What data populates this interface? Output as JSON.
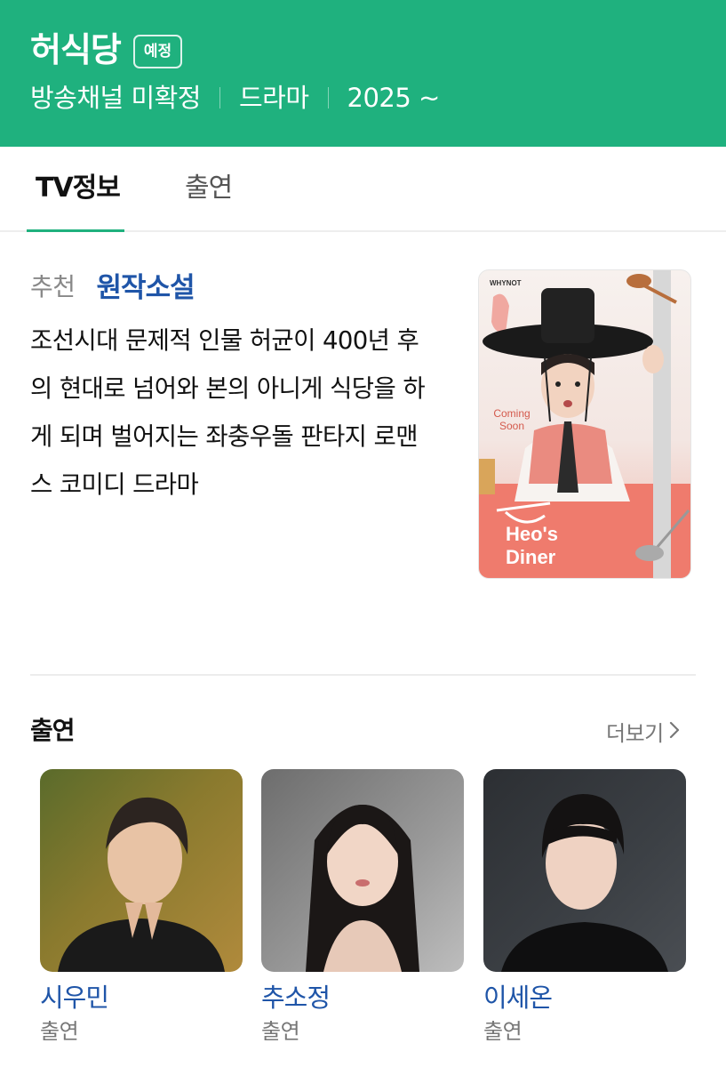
{
  "header": {
    "title": "허식당",
    "status_badge": "예정",
    "meta": [
      "방송채널 미확정",
      "드라마",
      "2025 ~"
    ],
    "bg_color": "#1fb17e"
  },
  "tabs": [
    {
      "label": "TV정보",
      "active": true
    },
    {
      "label": "출연",
      "active": false
    }
  ],
  "info": {
    "reco_label": "추천",
    "reco_link": "원작소설",
    "synopsis_lines": [
      "조선시대 문제적 인물 허균이 400년 후",
      "의 현대로 넘어와 본의 아니게 식당을 하",
      "게 되며 벌어지는 좌충우돌 판타지 로맨",
      "스 코미디 드라마"
    ]
  },
  "poster": {
    "brand": "WHYNOT",
    "coming_soon": "Coming Soon",
    "logo_line1": "Heo's",
    "logo_line2": "Diner"
  },
  "cast_section": {
    "title": "출연",
    "more_label": "더보기",
    "members": [
      {
        "name": "시우민",
        "role": "출연"
      },
      {
        "name": "추소정",
        "role": "출연"
      },
      {
        "name": "이세온",
        "role": "출연"
      }
    ]
  },
  "colors": {
    "accent": "#1fb17e",
    "link": "#1f55a8"
  }
}
